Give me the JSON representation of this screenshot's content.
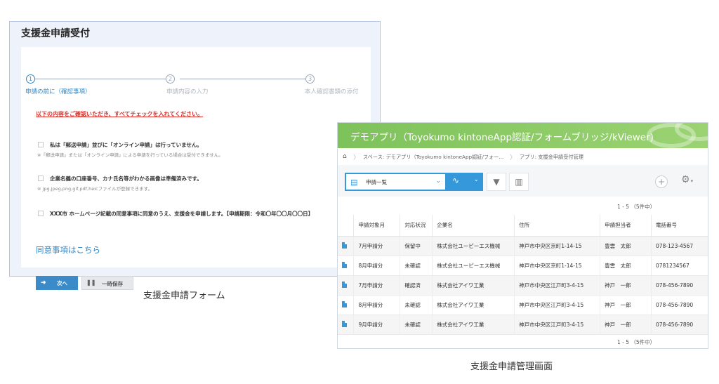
{
  "form": {
    "title": "支援金申請受付",
    "steps": [
      {
        "num": "1",
        "label": "申請の前に（確認事項）",
        "active": true
      },
      {
        "num": "2",
        "label": "申請内容の入力",
        "active": false
      },
      {
        "num": "3",
        "label": "本人確認書類の添付",
        "active": false
      }
    ],
    "notice": "以下の内容をご確認いただき、すべてチェックを入れてください。",
    "checks": [
      {
        "text": "私は「郵送申請」並びに「オンライン申請」は行っていません。",
        "note": "※「郵送申請」または「オンライン申請」による申請を行っている場合は受付できません。"
      },
      {
        "text": "企業名義の口座番号、カナ氏名等がわかる画像は準備済みです。",
        "note": "※ jpg,jpeg,png,gif,pdf,heicファイルが登録できます。"
      },
      {
        "text": "XXX市 ホームページ記載の同意事項に同意のうえ、支援金を申請します。【申請期限：令和〇年〇〇月〇〇日】",
        "note": ""
      }
    ],
    "agree_link": "同意事項はこちら",
    "next_label": "次へ",
    "save_label": "一時保存"
  },
  "captions": {
    "form": "支援金申請フォーム",
    "admin": "支援金申請管理画面"
  },
  "kintone": {
    "title": "デモアプリ（Toyokumo kintoneApp認証/フォームブリッジ/kViewer)",
    "breadcrumb_space": "スペース: デモアプリ（Toyokumo kintoneApp認証/フォー...",
    "breadcrumb_app": "アプリ: 支援金申請受付管理",
    "view_select": "申請一覧",
    "pager_top": "1 - 5 （5件中）",
    "pager_bottom": "1 - 5 （5件中）",
    "columns": [
      "申請対象月",
      "対応状況",
      "企業名",
      "住所",
      "申請担当者",
      "電話番号"
    ],
    "rows": [
      [
        "7月申請分",
        "保留中",
        "株式会社ユーピーエス機械",
        "神戸市中央区京町1-14-15",
        "豊雲　太郎",
        "078-123-4567"
      ],
      [
        "8月申請分",
        "未確認",
        "株式会社ユーピーエス機械",
        "神戸市中央区京町1-14-15",
        "豊雲　太郎",
        "0781234567"
      ],
      [
        "7月申請分",
        "確認済",
        "株式会社アイワ工業",
        "神戸市中央区江戸町3-4-15",
        "神戸　一郎",
        "078-456-7890"
      ],
      [
        "8月申請分",
        "未確認",
        "株式会社アイワ工業",
        "神戸市中央区江戸町3-4-15",
        "神戸　一郎",
        "078-456-7890"
      ],
      [
        "9月申請分",
        "未確認",
        "株式会社アイワ工業",
        "神戸市中央区江戸町3-4-15",
        "神戸　一郎",
        "078-456-7890"
      ]
    ]
  },
  "colors": {
    "accent_blue": "#3498db",
    "header_green": "#8cc965",
    "notice_red": "#e0302a"
  }
}
